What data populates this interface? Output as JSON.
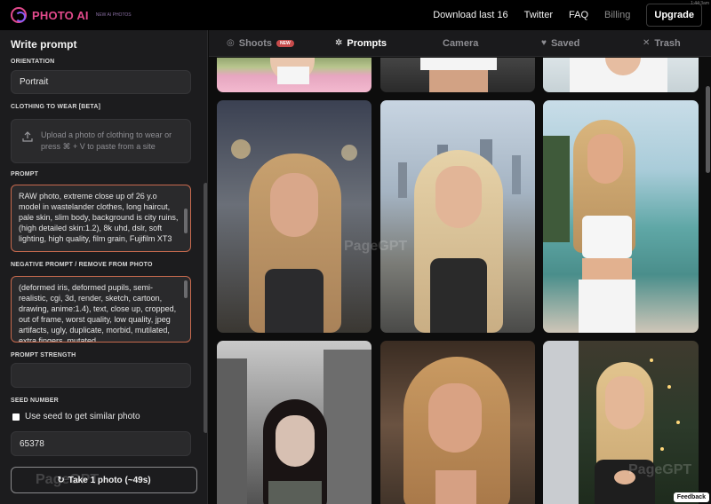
{
  "topbar": {
    "brand": "PHOTO AI",
    "brand_sub": "NEW AI PHOTOS",
    "nav": [
      "Download last 16",
      "Twitter",
      "FAQ",
      "Billing"
    ],
    "upgrade_label": "Upgrade",
    "corner_time": "1:44:3am"
  },
  "sidebar": {
    "title": "Write prompt",
    "orientation_label": "ORIENTATION",
    "orientation_value": "Portrait",
    "clothing_label": "CLOTHING TO WEAR [BETA]",
    "upload_text": "Upload a photo of clothing to wear or press ⌘ + V to paste from a site",
    "prompt_label": "PROMPT",
    "prompt_text": "RAW photo, extreme close up of 26 y.o model in wastelander clothes, long haircut, pale skin, slim body, background is city ruins, (high detailed skin:1.2), 8k uhd, dslr, soft lighting, high quality, film grain, Fujifilm XT3",
    "negative_label": "NEGATIVE PROMPT / REMOVE FROM PHOTO",
    "negative_text": "(deformed iris, deformed pupils, semi-realistic, cgi, 3d, render, sketch, cartoon, drawing, anime:1.4), text, close up, cropped, out of frame, worst quality, low quality, jpeg artifacts, ugly, duplicate, morbid, mutilated, extra fingers, mutated",
    "strength_label": "PROMPT STRENGTH",
    "strength_value": "",
    "seed_label": "SEED NUMBER",
    "seed_checkbox_label": "Use seed to get similar photo",
    "seed_value": "65378",
    "take_photo_label": "Take 1 photo (~49s)"
  },
  "tabs": [
    {
      "label": "Shoots",
      "badge": "NEW",
      "icon": "aperture-icon"
    },
    {
      "label": "Prompts",
      "icon": "sparkle-icon",
      "active": true
    },
    {
      "label": "Camera",
      "icon": "camera-icon"
    },
    {
      "label": "Saved",
      "icon": "heart-icon"
    },
    {
      "label": "Trash",
      "icon": "x-icon"
    }
  ],
  "feedback_label": "Feedback",
  "watermark": "PageGPT",
  "colors": {
    "accent": "#e24a8c",
    "prompt_border": "#c86a4e",
    "sidebar_bg": "#1c1c1e"
  }
}
